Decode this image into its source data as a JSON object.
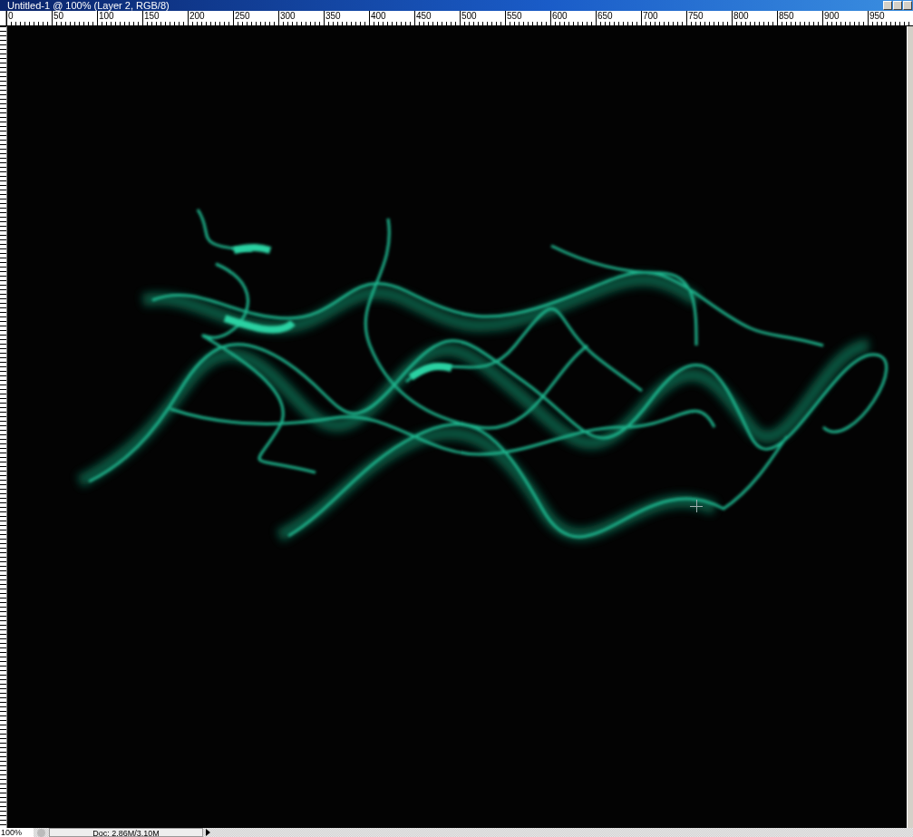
{
  "window": {
    "title": "Untitled-1 @ 100% (Layer 2, RGB/8)"
  },
  "ruler": {
    "labels": [
      "0",
      "50",
      "100",
      "150",
      "200",
      "250",
      "300",
      "350",
      "400",
      "450",
      "500",
      "550",
      "600",
      "650",
      "700",
      "750",
      "800",
      "850",
      "900",
      "950"
    ]
  },
  "status_bar": {
    "zoom": "100%",
    "doc_size": "Doc: 2.86M/3.10M"
  }
}
